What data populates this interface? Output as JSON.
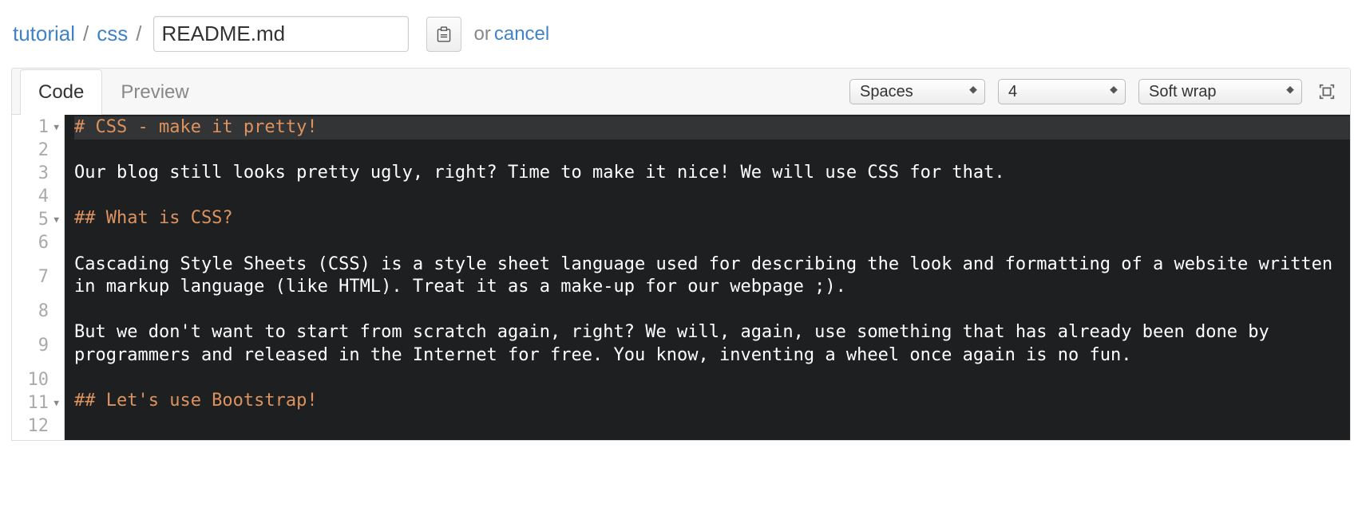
{
  "breadcrumb": {
    "root": "tutorial",
    "folder": "css",
    "filename": "README.md",
    "or": "or",
    "cancel": "cancel"
  },
  "tabs": {
    "code": "Code",
    "preview": "Preview"
  },
  "toolbar": {
    "indent_mode": "Spaces",
    "indent_size": "4",
    "wrap_mode": "Soft wrap"
  },
  "editor": {
    "lines": [
      {
        "num": "1",
        "fold": true,
        "hl": true,
        "cls": "hd",
        "text": "# CSS - make it pretty!"
      },
      {
        "num": "2",
        "fold": false,
        "hl": false,
        "cls": "tx",
        "text": ""
      },
      {
        "num": "3",
        "fold": false,
        "hl": false,
        "cls": "tx",
        "text": "Our blog still looks pretty ugly, right? Time to make it nice! We will use CSS for that."
      },
      {
        "num": "4",
        "fold": false,
        "hl": false,
        "cls": "tx",
        "text": ""
      },
      {
        "num": "5",
        "fold": true,
        "hl": false,
        "cls": "hd",
        "text": "## What is CSS?"
      },
      {
        "num": "6",
        "fold": false,
        "hl": false,
        "cls": "tx",
        "text": ""
      },
      {
        "num": "7",
        "fold": false,
        "hl": false,
        "cls": "tx",
        "text": "Cascading Style Sheets (CSS) is a style sheet language used for describing the look and formatting of a website written in markup language (like HTML). Treat it as a make-up for our webpage ;)."
      },
      {
        "num": "8",
        "fold": false,
        "hl": false,
        "cls": "tx",
        "text": ""
      },
      {
        "num": "9",
        "fold": false,
        "hl": false,
        "cls": "tx",
        "text": "But we don't want to start from scratch again, right? We will, again, use something that has already been done by programmers and released in the Internet for free. You know, inventing a wheel once again is no fun."
      },
      {
        "num": "10",
        "fold": false,
        "hl": false,
        "cls": "tx",
        "text": ""
      },
      {
        "num": "11",
        "fold": true,
        "hl": false,
        "cls": "hd",
        "text": "## Let's use Bootstrap!"
      },
      {
        "num": "12",
        "fold": false,
        "hl": false,
        "cls": "tx",
        "text": ""
      }
    ]
  }
}
